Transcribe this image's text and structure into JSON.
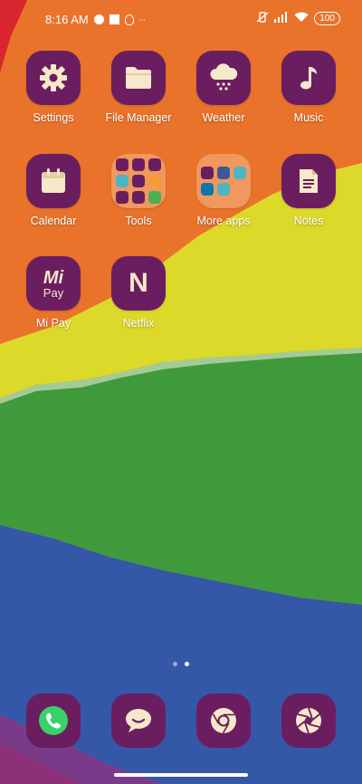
{
  "status_bar": {
    "time": "8:16 AM",
    "battery": "100"
  },
  "apps": [
    {
      "label": "Settings",
      "icon": "gear-icon"
    },
    {
      "label": "File Manager",
      "icon": "folder-icon"
    },
    {
      "label": "Weather",
      "icon": "weather-cloud-icon"
    },
    {
      "label": "Music",
      "icon": "music-note-icon"
    },
    {
      "label": "Calendar",
      "icon": "calendar-icon"
    },
    {
      "label": "Tools",
      "icon": "folder-grid-icon"
    },
    {
      "label": "More apps",
      "icon": "folder-grid-icon"
    },
    {
      "label": "Notes",
      "icon": "document-icon"
    },
    {
      "label": "Mi Pay",
      "icon": "mi-pay-icon"
    },
    {
      "label": "Netflix",
      "icon": "netflix-icon"
    }
  ],
  "mipay_icon_text": {
    "top": "Mi",
    "bottom": "Pay"
  },
  "netflix_icon_text": "N",
  "dock": [
    {
      "name": "Phone",
      "icon": "phone-icon"
    },
    {
      "name": "Messaging",
      "icon": "chat-bubble-icon"
    },
    {
      "name": "Chrome",
      "icon": "chrome-icon"
    },
    {
      "name": "Camera",
      "icon": "camera-aperture-icon"
    }
  ],
  "colors": {
    "icon_bg": "#6a1e60",
    "icon_fg": "#f6e8c8",
    "phone_green": "#3ad06a"
  },
  "pages": {
    "count": 2,
    "active": 2
  }
}
